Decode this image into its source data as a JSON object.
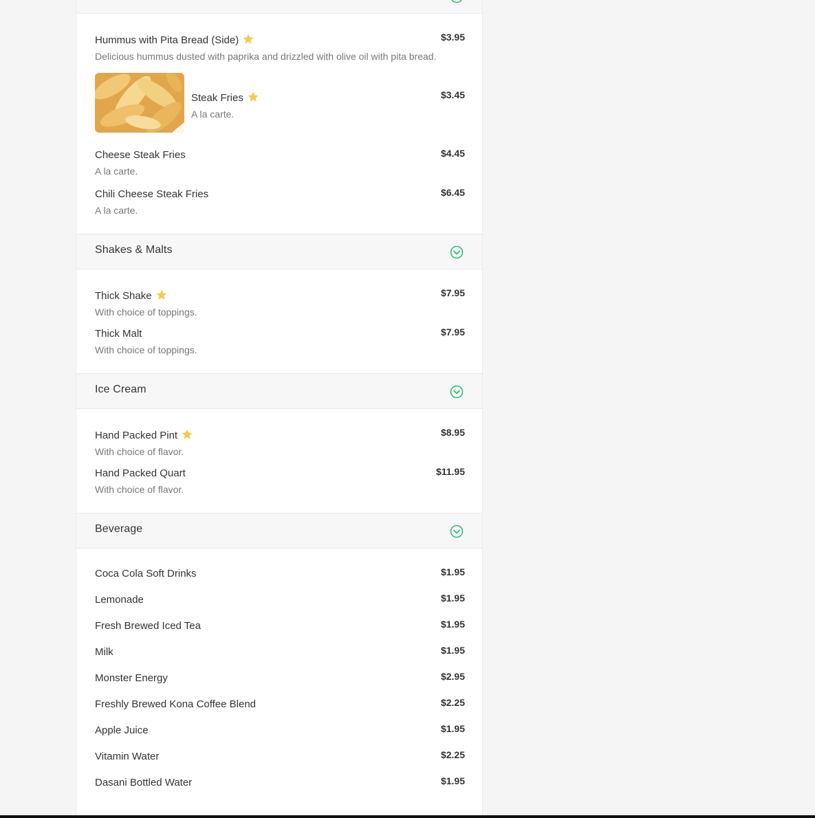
{
  "colors": {
    "accent": "#2fbf71",
    "star": "#f7c948",
    "text": "#333333",
    "muted": "#777777"
  },
  "sections": {
    "shakes": {
      "title": "Shakes & Malts"
    },
    "ice_cream": {
      "title": "Ice Cream"
    },
    "beverage": {
      "title": "Beverage"
    }
  },
  "items": {
    "hummus": {
      "name": "Hummus with Pita Bread (Side)",
      "desc": "Delicious hummus dusted with paprika and drizzled with olive oil with pita bread.",
      "price": "$3.95",
      "popular": true
    },
    "steak_fries": {
      "name": "Steak Fries",
      "desc": "A la carte.",
      "price": "$3.45",
      "popular": true,
      "image": "fries-photo"
    },
    "cheese_steak_fries": {
      "name": "Cheese Steak Fries",
      "desc": "A la carte.",
      "price": "$4.45"
    },
    "chili_cheese_steak_fries": {
      "name": "Chili Cheese Steak Fries",
      "desc": "A la carte.",
      "price": "$6.45"
    },
    "thick_shake": {
      "name": "Thick Shake",
      "desc": "With choice of toppings.",
      "price": "$7.95",
      "popular": true
    },
    "thick_malt": {
      "name": "Thick Malt",
      "desc": "With choice of toppings.",
      "price": "$7.95"
    },
    "hand_packed_pint": {
      "name": "Hand Packed Pint",
      "desc": "With choice of flavor.",
      "price": "$8.95",
      "popular": true
    },
    "hand_packed_quart": {
      "name": "Hand Packed Quart",
      "desc": "With choice of flavor.",
      "price": "$11.95"
    }
  },
  "beverages": [
    {
      "name": "Coca Cola Soft Drinks",
      "price": "$1.95"
    },
    {
      "name": "Lemonade",
      "price": "$1.95"
    },
    {
      "name": "Fresh Brewed Iced Tea",
      "price": "$1.95"
    },
    {
      "name": "Milk",
      "price": "$1.95"
    },
    {
      "name": "Monster Energy",
      "price": "$2.95"
    },
    {
      "name": "Freshly Brewed Kona Coffee Blend",
      "price": "$2.25"
    },
    {
      "name": "Apple Juice",
      "price": "$1.95"
    },
    {
      "name": "Vitamin Water",
      "price": "$2.25"
    },
    {
      "name": "Dasani Bottled Water",
      "price": "$1.95"
    }
  ]
}
